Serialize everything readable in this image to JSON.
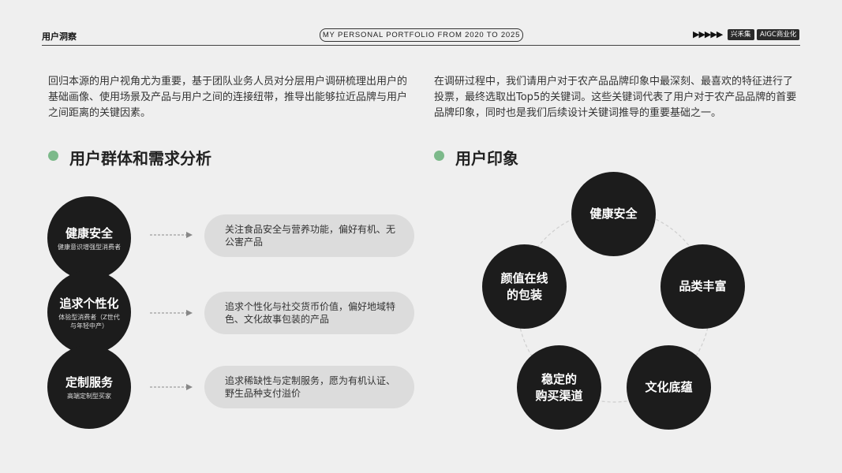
{
  "header": {
    "title": "用户洞察",
    "portfolio": "MY PERSONAL PORTFOLIO FROM 2020 TO 2025",
    "arrows": "▶▶▶▶▶",
    "tags": [
      "兴禾集",
      "AIGC商业化"
    ]
  },
  "intro": {
    "left": "回归本源的用户视角尤为重要，基于团队业务人员对分层用户调研梳理出用户的基础画像、使用场景及产品与用户之间的连接纽带，推导出能够拉近品牌与用户之间距离的关键因素。",
    "right": "在调研过程中，我们请用户对于农产品品牌印象中最深刻、最喜欢的特征进行了投票，最终选取出Top5的关键词。这些关键词代表了用户对于农产品品牌的首要品牌印象，同时也是我们后续设计关键词推导的重要基础之一。"
  },
  "sections": {
    "needs_title": "用户群体和需求分析",
    "impression_title": "用户印象"
  },
  "needs": [
    {
      "title": "健康安全",
      "sub": "健康意识增强型消费者",
      "desc": "关注食品安全与营养功能，偏好有机、无公害产品"
    },
    {
      "title": "追求个性化",
      "sub": "体验型消费者（Z世代与年轻中产）",
      "desc": "追求个性化与社交货币价值，偏好地域特色、文化故事包装的产品"
    },
    {
      "title": "定制服务",
      "sub": "高端定制型买家",
      "desc": "追求稀缺性与定制服务，愿为有机认证、野生品种支付溢价"
    }
  ],
  "impressions": {
    "top": "健康安全",
    "right": "品类丰富",
    "bottom_right": "文化底蕴",
    "bottom_left": "稳定的\n购买渠道",
    "left": "颜值在线\n的包装"
  }
}
